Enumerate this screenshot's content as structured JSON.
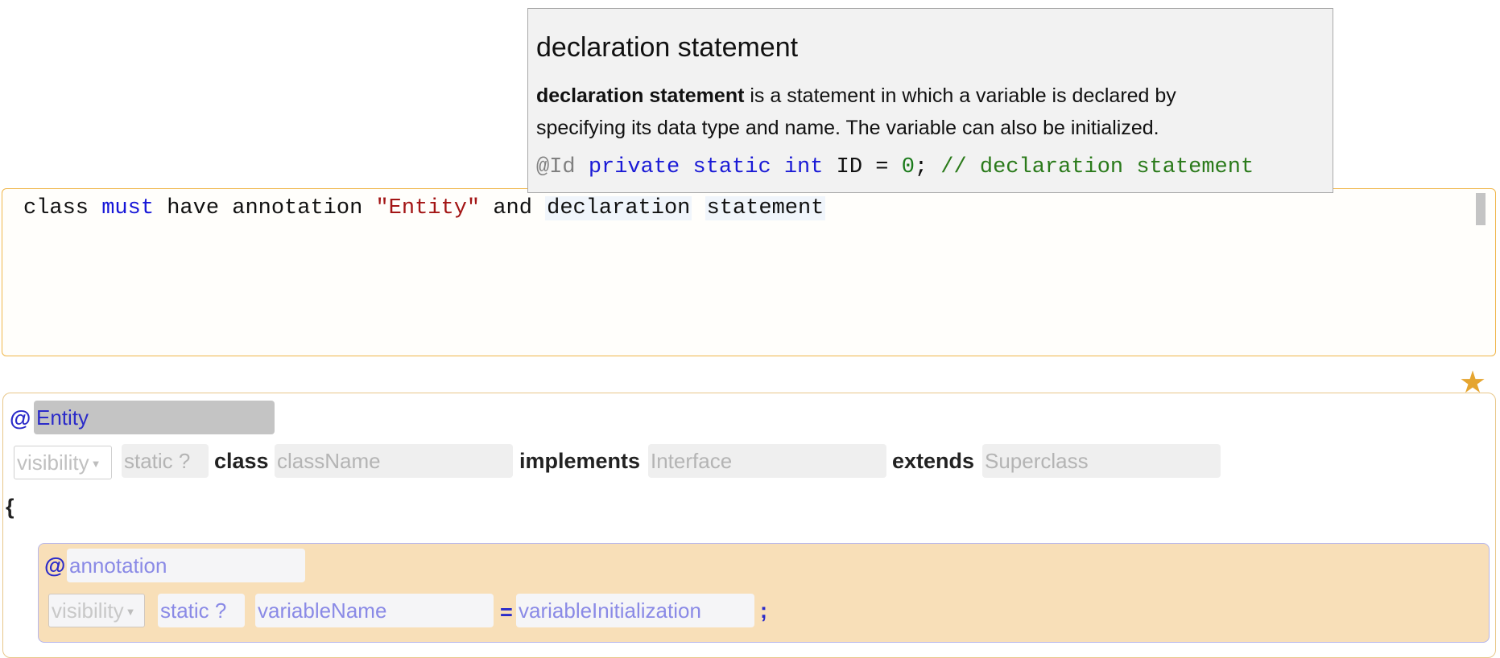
{
  "tooltip": {
    "title": "declaration statement",
    "description_bold": "declaration statement",
    "description_rest": " is a statement in which a variable is declared by",
    "description_line2": "specifying its data type and name. The variable can also be initialized.",
    "code": {
      "annotation": "@Id",
      "kw_private": "private",
      "kw_static": "static",
      "kw_int": "int",
      "ident": "ID =",
      "number": "0",
      "semicolon": ";",
      "comment": "// declaration statement"
    }
  },
  "rule": {
    "w_class": "class",
    "w_must": "must",
    "w_have_annotation": "have annotation",
    "w_entity": "\"Entity\"",
    "w_and": "and",
    "w_declaration": "declaration",
    "w_statement": "statement"
  },
  "class_panel": {
    "at_symbol": "@",
    "annotation_value": "Entity",
    "visibility_placeholder": "visibility",
    "static_placeholder": "static ?",
    "kw_class": "class",
    "class_name_placeholder": "className",
    "kw_implements": "implements",
    "interface_placeholder": "Interface",
    "kw_extends": "extends",
    "superclass_placeholder": "Superclass",
    "open_brace": "{"
  },
  "member_panel": {
    "at_symbol": "@",
    "annotation_placeholder": "annotation",
    "visibility_placeholder": "visibility",
    "static_placeholder": "static ?",
    "variable_name_placeholder": "variableName",
    "equals": "=",
    "initialization_placeholder": "variableInitialization",
    "semicolon": ";"
  },
  "icons": {
    "star_active": "star-icon",
    "star_inactive": "star-icon"
  },
  "colors": {
    "keyword_blue": "#1616d8",
    "string_red": "#a31515",
    "rule_border": "#f0b64a",
    "member_bg": "#f8dfb8",
    "star_active": "#e5a530"
  }
}
